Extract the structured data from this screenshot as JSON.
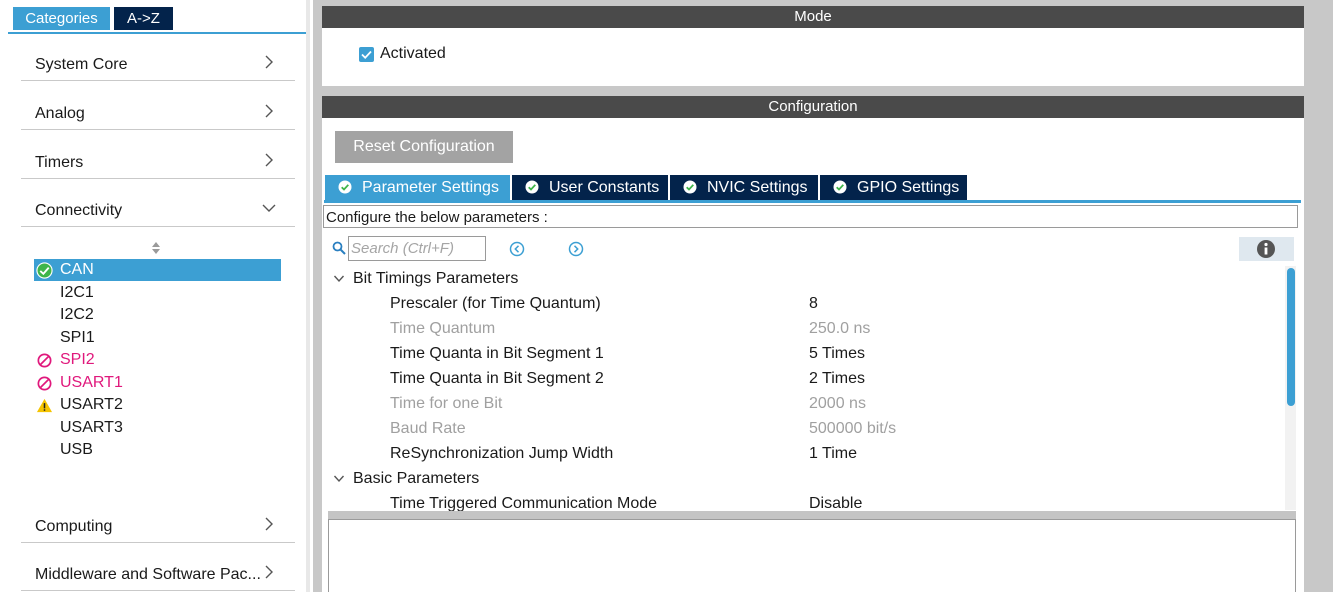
{
  "left": {
    "tabs": {
      "categories": "Categories",
      "az": "A->Z"
    },
    "categories": [
      {
        "label": "System Core",
        "state": "collapsed"
      },
      {
        "label": "Analog",
        "state": "collapsed"
      },
      {
        "label": "Timers",
        "state": "collapsed"
      },
      {
        "label": "Connectivity",
        "state": "expanded"
      },
      {
        "label": "Computing",
        "state": "collapsed"
      },
      {
        "label": "Middleware and Software Pac...",
        "state": "collapsed"
      }
    ],
    "connectivity_items": [
      {
        "label": "CAN",
        "status": "ok",
        "selected": true
      },
      {
        "label": "I2C1",
        "status": "none"
      },
      {
        "label": "I2C2",
        "status": "none"
      },
      {
        "label": "SPI1",
        "status": "none"
      },
      {
        "label": "SPI2",
        "status": "conflict"
      },
      {
        "label": "USART1",
        "status": "conflict"
      },
      {
        "label": "USART2",
        "status": "warning"
      },
      {
        "label": "USART3",
        "status": "none"
      },
      {
        "label": "USB",
        "status": "none"
      }
    ]
  },
  "mode": {
    "header": "Mode",
    "activated_label": "Activated",
    "activated": true
  },
  "configuration": {
    "header": "Configuration",
    "reset_label": "Reset Configuration",
    "tabs": [
      "Parameter Settings",
      "User Constants",
      "NVIC Settings",
      "GPIO Settings"
    ],
    "active_tab": "Parameter Settings",
    "info_text": "Configure the below parameters :",
    "search_placeholder": "Search (Ctrl+F)",
    "groups": [
      {
        "name": "Bit Timings Parameters",
        "params": [
          {
            "name": "Prescaler (for Time Quantum)",
            "value": "8",
            "editable": true
          },
          {
            "name": "Time Quantum",
            "value": "250.0 ns",
            "editable": false
          },
          {
            "name": "Time Quanta in Bit Segment 1",
            "value": "5 Times",
            "editable": true
          },
          {
            "name": "Time Quanta in Bit Segment 2",
            "value": "2 Times",
            "editable": true
          },
          {
            "name": "Time for one Bit",
            "value": "2000 ns",
            "editable": false
          },
          {
            "name": "Baud Rate",
            "value": "500000 bit/s",
            "editable": false
          },
          {
            "name": "ReSynchronization Jump Width",
            "value": "1 Time",
            "editable": true
          }
        ]
      },
      {
        "name": "Basic Parameters",
        "params": [
          {
            "name": "Time Triggered Communication Mode",
            "value": "Disable",
            "editable": true
          }
        ]
      }
    ]
  },
  "colors": {
    "accent": "#3c9fd3",
    "navy": "#03234b",
    "header": "#4a4a4a",
    "conflict": "#e0187c",
    "warning": "#f5c400",
    "ok": "#3fb549"
  }
}
